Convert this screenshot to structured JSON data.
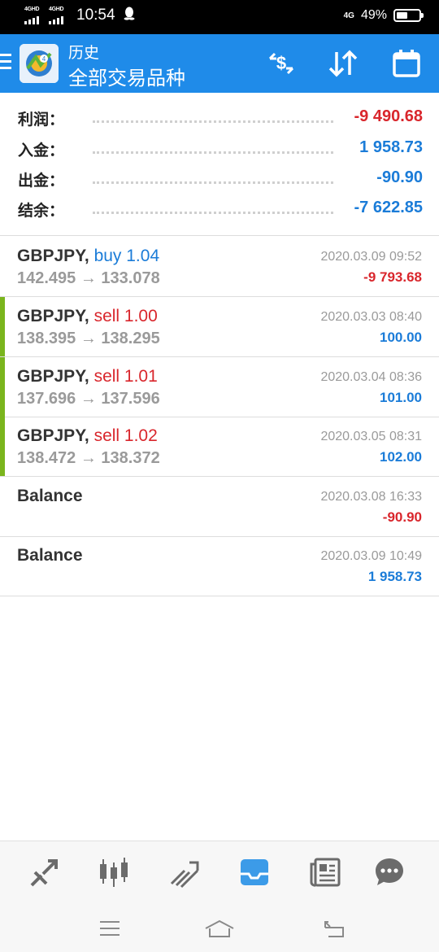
{
  "status_bar": {
    "signal_1": "4GHD",
    "signal_2": "4GHD",
    "time": "10:54",
    "network": "4G",
    "battery_pct": "49%",
    "battery_level": 0.49
  },
  "app_bar": {
    "title": "历史",
    "subtitle": "全部交易品种",
    "icons": [
      "menu-icon",
      "app-logo",
      "currency-exchange-icon",
      "sort-icon",
      "calendar-icon"
    ]
  },
  "summary": {
    "profit_label": "利润：",
    "profit_value": "-9 490.68",
    "deposit_label": "入金：",
    "deposit_value": "1 958.73",
    "withdrawal_label": "出金：",
    "withdrawal_value": "-90.90",
    "balance_label": "结余：",
    "balance_value": "-7 622.85"
  },
  "trades": [
    {
      "symbol": "GBPJPY,",
      "side": "buy 1.04",
      "prices": "142.495 → 133.078",
      "date": "2020.03.09 09:52",
      "profit": "-9 793.68"
    },
    {
      "symbol": "GBPJPY,",
      "side": "sell 1.00",
      "prices": "138.395 → 138.295",
      "date": "2020.03.03 08:40",
      "profit": "100.00"
    },
    {
      "symbol": "GBPJPY,",
      "side": "sell 1.01",
      "prices": "137.696 → 137.596",
      "date": "2020.03.04 08:36",
      "profit": "101.00"
    },
    {
      "symbol": "GBPJPY,",
      "side": "sell 1.02",
      "prices": "138.472 → 138.372",
      "date": "2020.03.05 08:31",
      "profit": "102.00"
    },
    {
      "symbol": "Balance",
      "side": "",
      "prices": "",
      "date": "2020.03.08 16:33",
      "profit": "-90.90"
    },
    {
      "symbol": "Balance",
      "side": "",
      "prices": "",
      "date": "2020.03.09 10:49",
      "profit": "1 958.73"
    }
  ],
  "tabs": [
    "quotes-tab",
    "chart-tab",
    "trade-tab",
    "history-tab",
    "news-tab",
    "chat-tab"
  ],
  "nav_keys": [
    "menu-key",
    "home-key",
    "back-key"
  ],
  "colors": {
    "accent": "#1f8be9",
    "loss": "#d9262c",
    "gain": "#1b7cd8",
    "sell_marker": "#7ab51d",
    "tab_icon": "#6b6b6b",
    "tab_active": "#3c9be8"
  }
}
